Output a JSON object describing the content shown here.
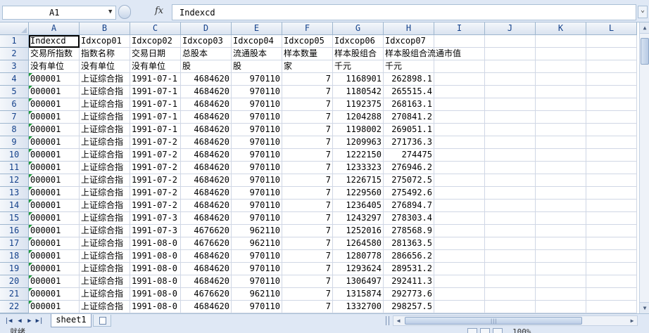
{
  "formula_bar": {
    "name_box": "A1",
    "fx_label": "fx",
    "formula": "Indexcd"
  },
  "columns": [
    "A",
    "B",
    "C",
    "D",
    "E",
    "F",
    "G",
    "H",
    "I",
    "J",
    "K",
    "L"
  ],
  "rows": [
    {
      "num": "1",
      "cells": [
        "Indexcd",
        "Idxcop01",
        "Idxcop02",
        "Idxcop03",
        "Idxcop04",
        "Idxcop05",
        "Idxcop06",
        "Idxcop07",
        "",
        "",
        "",
        ""
      ]
    },
    {
      "num": "2",
      "cells": [
        "交易所指数",
        "指数名称",
        "交易日期",
        "总股本",
        "流通股本",
        "样本数量",
        "样本股组合",
        "样本股组合流通市值",
        "",
        "",
        "",
        ""
      ]
    },
    {
      "num": "3",
      "cells": [
        "没有单位",
        "没有单位",
        "没有单位",
        "股",
        "股",
        "家",
        "千元",
        "千元",
        "",
        "",
        "",
        ""
      ]
    },
    {
      "num": "4",
      "cells": [
        "000001",
        "上证综合指",
        "1991-07-1",
        "4684620",
        "970110",
        "7",
        "1168901",
        "262898.1",
        "",
        "",
        "",
        ""
      ]
    },
    {
      "num": "5",
      "cells": [
        "000001",
        "上证综合指",
        "1991-07-1",
        "4684620",
        "970110",
        "7",
        "1180542",
        "265515.4",
        "",
        "",
        "",
        ""
      ]
    },
    {
      "num": "6",
      "cells": [
        "000001",
        "上证综合指",
        "1991-07-1",
        "4684620",
        "970110",
        "7",
        "1192375",
        "268163.1",
        "",
        "",
        "",
        ""
      ]
    },
    {
      "num": "7",
      "cells": [
        "000001",
        "上证综合指",
        "1991-07-1",
        "4684620",
        "970110",
        "7",
        "1204288",
        "270841.2",
        "",
        "",
        "",
        ""
      ]
    },
    {
      "num": "8",
      "cells": [
        "000001",
        "上证综合指",
        "1991-07-1",
        "4684620",
        "970110",
        "7",
        "1198002",
        "269051.1",
        "",
        "",
        "",
        ""
      ]
    },
    {
      "num": "9",
      "cells": [
        "000001",
        "上证综合指",
        "1991-07-2",
        "4684620",
        "970110",
        "7",
        "1209963",
        "271736.3",
        "",
        "",
        "",
        ""
      ]
    },
    {
      "num": "10",
      "cells": [
        "000001",
        "上证综合指",
        "1991-07-2",
        "4684620",
        "970110",
        "7",
        "1222150",
        "274475",
        "",
        "",
        "",
        ""
      ]
    },
    {
      "num": "11",
      "cells": [
        "000001",
        "上证综合指",
        "1991-07-2",
        "4684620",
        "970110",
        "7",
        "1233323",
        "276946.2",
        "",
        "",
        "",
        ""
      ]
    },
    {
      "num": "12",
      "cells": [
        "000001",
        "上证综合指",
        "1991-07-2",
        "4684620",
        "970110",
        "7",
        "1226715",
        "275072.5",
        "",
        "",
        "",
        ""
      ]
    },
    {
      "num": "13",
      "cells": [
        "000001",
        "上证综合指",
        "1991-07-2",
        "4684620",
        "970110",
        "7",
        "1229560",
        "275492.6",
        "",
        "",
        "",
        ""
      ]
    },
    {
      "num": "14",
      "cells": [
        "000001",
        "上证综合指",
        "1991-07-2",
        "4684620",
        "970110",
        "7",
        "1236405",
        "276894.7",
        "",
        "",
        "",
        ""
      ]
    },
    {
      "num": "15",
      "cells": [
        "000001",
        "上证综合指",
        "1991-07-3",
        "4684620",
        "970110",
        "7",
        "1243297",
        "278303.4",
        "",
        "",
        "",
        ""
      ]
    },
    {
      "num": "16",
      "cells": [
        "000001",
        "上证综合指",
        "1991-07-3",
        "4676620",
        "962110",
        "7",
        "1252016",
        "278568.9",
        "",
        "",
        "",
        ""
      ]
    },
    {
      "num": "17",
      "cells": [
        "000001",
        "上证综合指",
        "1991-08-0",
        "4676620",
        "962110",
        "7",
        "1264580",
        "281363.5",
        "",
        "",
        "",
        ""
      ]
    },
    {
      "num": "18",
      "cells": [
        "000001",
        "上证综合指",
        "1991-08-0",
        "4684620",
        "970110",
        "7",
        "1280778",
        "286656.2",
        "",
        "",
        "",
        ""
      ]
    },
    {
      "num": "19",
      "cells": [
        "000001",
        "上证综合指",
        "1991-08-0",
        "4684620",
        "970110",
        "7",
        "1293624",
        "289531.2",
        "",
        "",
        "",
        ""
      ]
    },
    {
      "num": "20",
      "cells": [
        "000001",
        "上证综合指",
        "1991-08-0",
        "4684620",
        "970110",
        "7",
        "1306497",
        "292411.3",
        "",
        "",
        "",
        ""
      ]
    },
    {
      "num": "21",
      "cells": [
        "000001",
        "上证综合指",
        "1991-08-0",
        "4676620",
        "962110",
        "7",
        "1315874",
        "292773.6",
        "",
        "",
        "",
        ""
      ]
    },
    {
      "num": "22",
      "cells": [
        "000001",
        "上证综合指",
        "1991-08-0",
        "4684620",
        "970110",
        "7",
        "1332700",
        "298257.5",
        "",
        "",
        "",
        ""
      ]
    }
  ],
  "sheet_tabs": [
    "sheet1"
  ],
  "status": {
    "text": "就绪",
    "zoom": "100%"
  },
  "colors": {
    "accent": "#dfe8f5",
    "header_text": "#15428b",
    "grid_line": "#d0d7e5",
    "error_triangle": "#1f9a3a"
  }
}
